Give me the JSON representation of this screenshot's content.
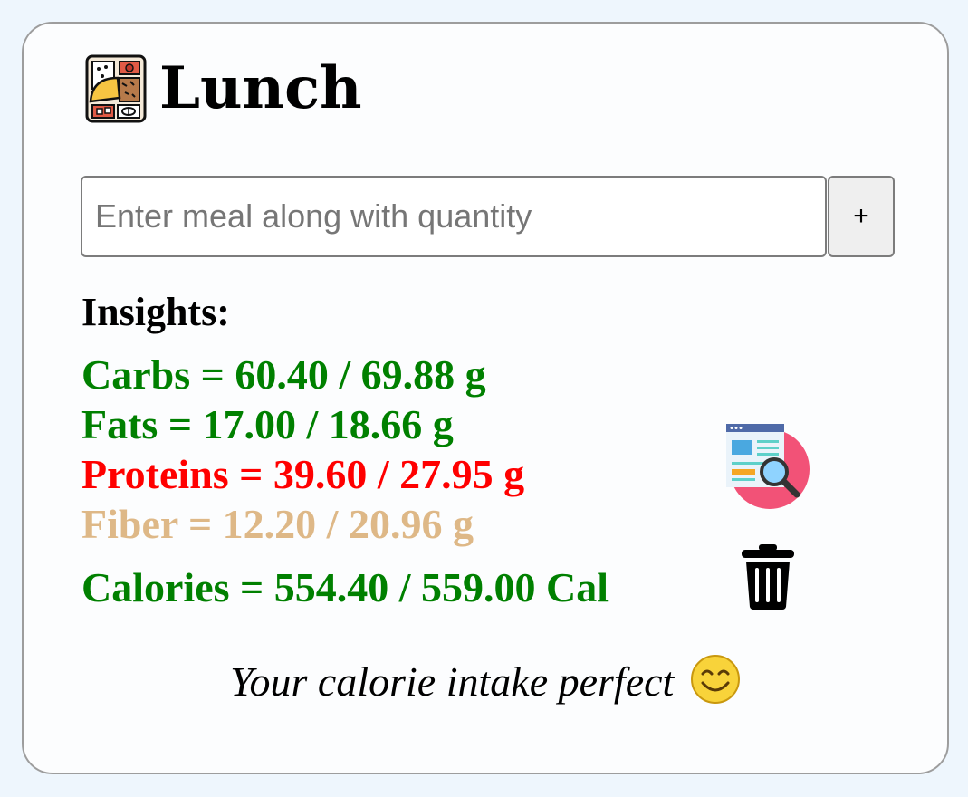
{
  "header": {
    "title": "Lunch",
    "icon": "bento-box-icon"
  },
  "meal_input": {
    "placeholder": "Enter meal along with quantity",
    "value": ""
  },
  "add_button": {
    "label": "+"
  },
  "insights": {
    "heading": "Insights:",
    "carbs": {
      "text": "Carbs = 60.40 / 69.88 g",
      "color": "#008000"
    },
    "fats": {
      "text": "Fats = 17.00 / 18.66 g",
      "color": "#008000"
    },
    "proteins": {
      "text": "Proteins = 39.60 / 27.95 g",
      "color": "#ff0000"
    },
    "fiber": {
      "text": "Fiber = 12.20 / 20.96 g",
      "color": "#deb887"
    },
    "calories": {
      "text": "Calories = 554.40 / 559.00 Cal",
      "color": "#008000"
    }
  },
  "icons": {
    "details": "report-search-icon",
    "delete": "trash-icon",
    "status": "smiley-icon"
  },
  "message": {
    "text": "Your calorie intake perfect"
  }
}
